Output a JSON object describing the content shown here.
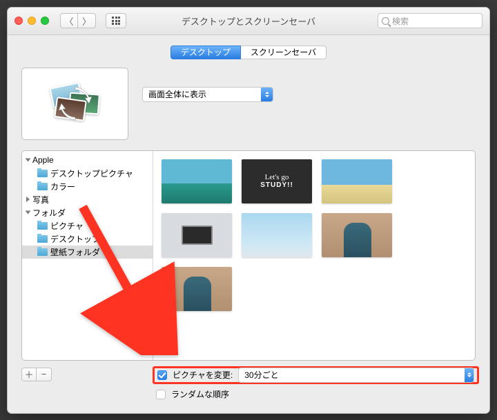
{
  "window": {
    "title": "デスクトップとスクリーンセーバ",
    "search_placeholder": "検索"
  },
  "tabs": {
    "desktop": "デスクトップ",
    "screensaver": "スクリーンセーバ"
  },
  "fit_mode": {
    "selected": "画面全体に表示"
  },
  "sidebar": {
    "groups": [
      {
        "label": "Apple",
        "expanded": true,
        "children": [
          {
            "label": "デスクトップピクチャ"
          },
          {
            "label": "カラー"
          }
        ]
      },
      {
        "label": "写真",
        "expanded": false,
        "children": []
      },
      {
        "label": "フォルダ",
        "expanded": true,
        "children": [
          {
            "label": "ピクチャ"
          },
          {
            "label": "デスクトップ"
          },
          {
            "label": "壁紙フォルダ",
            "selected": true
          }
        ]
      }
    ]
  },
  "thumbnails": {
    "study_line1": "Let's go",
    "study_line2": "STUDY!!"
  },
  "buttons": {
    "add": "＋",
    "remove": "−"
  },
  "options": {
    "change_picture_label": "ピクチャを変更:",
    "change_picture_checked": true,
    "interval_selected": "30分ごと",
    "random_label": "ランダムな順序",
    "random_checked": false
  }
}
